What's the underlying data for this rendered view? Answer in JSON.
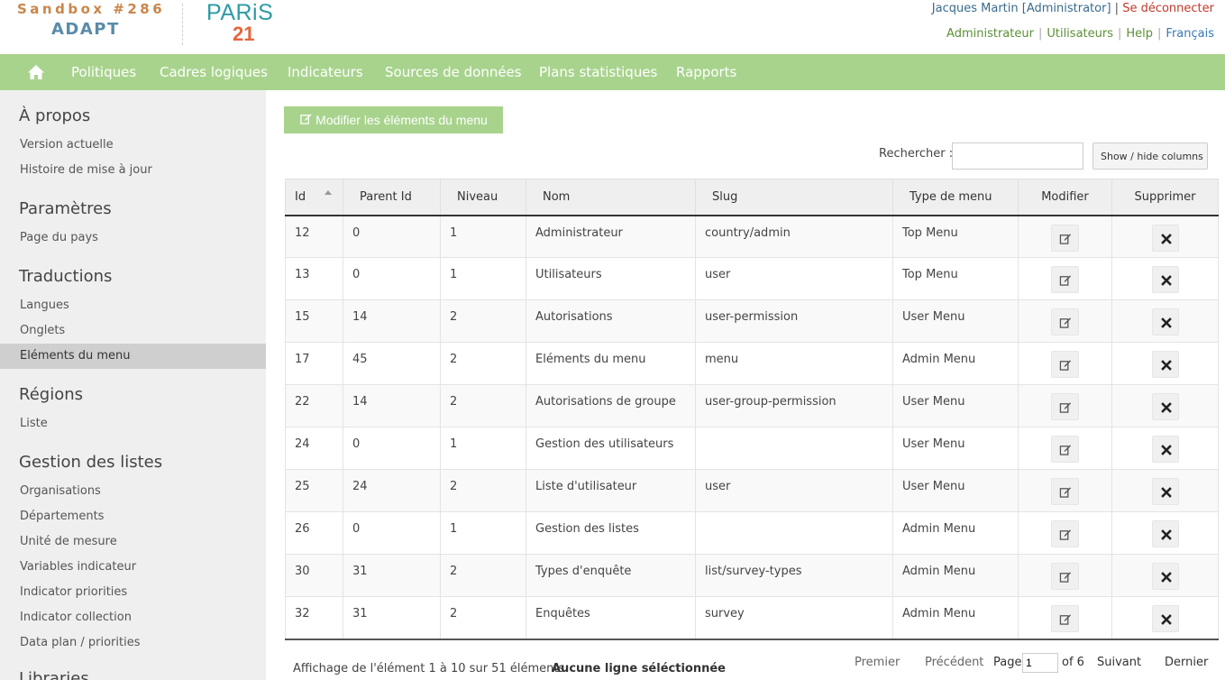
{
  "header": {
    "sandbox_label": "Sandbox #286",
    "adapt_label": "ADAPT",
    "logo_paris": "PARiS",
    "logo_21": "21",
    "user_name": "Jacques Martin [Administrator]",
    "logout": "Se déconnecter",
    "separator": "|",
    "links": [
      "Administrateur",
      "Utilisateurs",
      "Help",
      "Français"
    ]
  },
  "nav": {
    "items": [
      "Politiques",
      "Cadres logiques",
      "Indicateurs",
      "Sources de données",
      "Plans statistiques",
      "Rapports"
    ]
  },
  "sidebar": {
    "sections": [
      {
        "heading": "À propos",
        "links": [
          "Version actuelle",
          "Histoire de mise à jour"
        ]
      },
      {
        "heading": "Paramètres",
        "links": [
          "Page du pays"
        ]
      },
      {
        "heading": "Traductions",
        "links": [
          "Langues",
          "Onglets",
          "Eléments du menu"
        ]
      },
      {
        "heading": "Régions",
        "links": [
          "Liste"
        ]
      },
      {
        "heading": "Gestion des listes",
        "links": [
          "Organisations",
          "Départements",
          "Unité de mesure",
          "Variables indicateur",
          "Indicator priorities",
          "Indicator collection",
          "Data plan / priorities"
        ]
      },
      {
        "heading": "Libraries",
        "links": []
      }
    ],
    "active": "Eléments du menu"
  },
  "toolbar": {
    "edit_menu_label": "Modifier les éléments du menu",
    "search_label": "Rechercher :",
    "search_value": "",
    "columns_button": "Show / hide columns"
  },
  "table": {
    "columns": [
      "Id",
      "Parent Id",
      "Niveau",
      "Nom",
      "Slug",
      "Type de menu",
      "Modifier",
      "Supprimer"
    ],
    "rows": [
      [
        "12",
        "0",
        "1",
        "Administrateur",
        "country/admin",
        "Top Menu"
      ],
      [
        "13",
        "0",
        "1",
        "Utilisateurs",
        "user",
        "Top Menu"
      ],
      [
        "15",
        "14",
        "2",
        "Autorisations",
        "user-permission",
        "User Menu"
      ],
      [
        "17",
        "45",
        "2",
        "Eléments du menu",
        "menu",
        "Admin Menu"
      ],
      [
        "22",
        "14",
        "2",
        "Autorisations de groupe",
        "user-group-permission",
        "User Menu"
      ],
      [
        "24",
        "0",
        "1",
        "Gestion des utilisateurs",
        "",
        "User Menu"
      ],
      [
        "25",
        "24",
        "2",
        "Liste d'utilisateur",
        "user",
        "User Menu"
      ],
      [
        "26",
        "0",
        "1",
        "Gestion des listes",
        "",
        "Admin Menu"
      ],
      [
        "30",
        "31",
        "2",
        "Types d'enquête",
        "list/survey-types",
        "Admin Menu"
      ],
      [
        "32",
        "31",
        "2",
        "Enquêtes",
        "survey",
        "Admin Menu"
      ]
    ]
  },
  "footer": {
    "info": "Affichage de l'élément 1 à 10 sur 51 éléments",
    "selection": "Aucune ligne séléctionnée",
    "first": "Premier",
    "previous": "Précédent",
    "page_label": "Page",
    "page_value": "1",
    "of_label": "of 6",
    "next": "Suivant",
    "last": "Dernier"
  },
  "colors": {
    "nav_bg": "#a8d38d",
    "sidebar_bg": "#efefef",
    "logout": "#c0392b",
    "brand_orange": "#c8864a",
    "brand_blue": "#5b8ba8"
  }
}
